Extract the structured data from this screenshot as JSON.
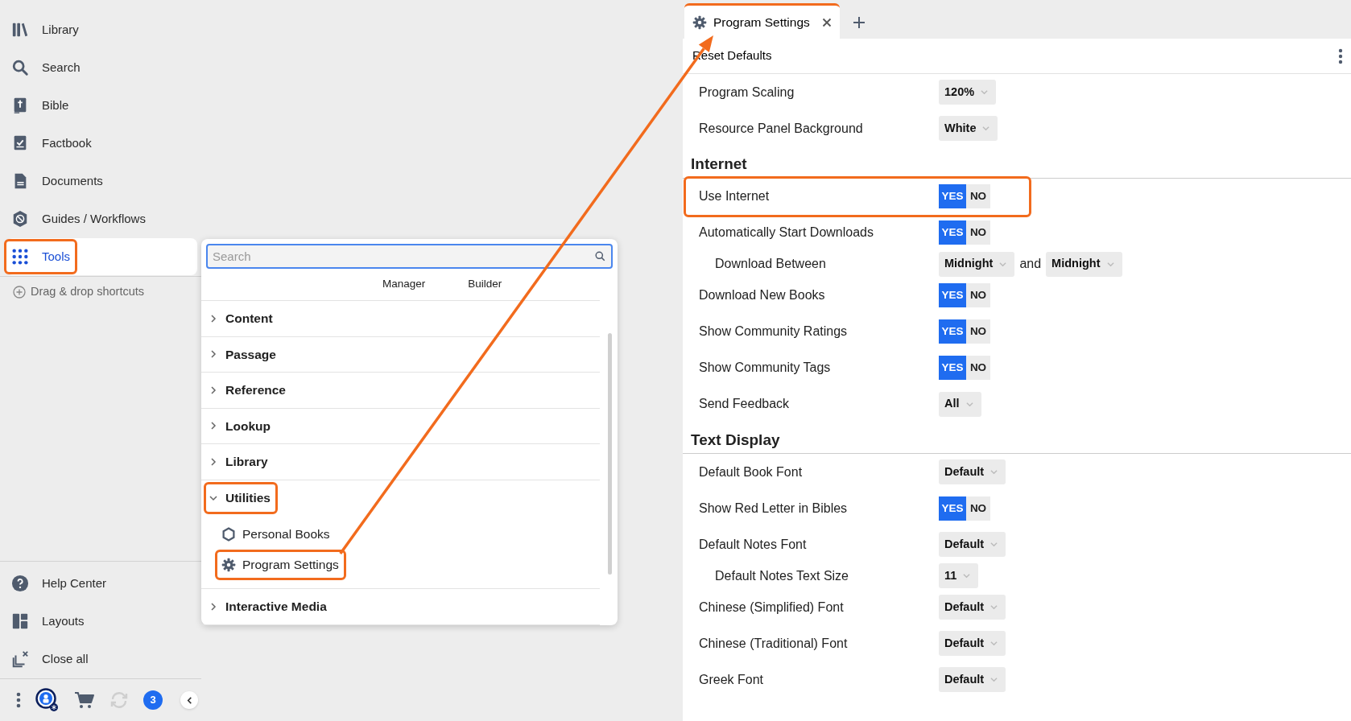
{
  "sidebar": {
    "items": [
      {
        "label": "Library",
        "selected": false,
        "highlighted": false
      },
      {
        "label": "Search",
        "selected": false,
        "highlighted": false
      },
      {
        "label": "Bible",
        "selected": false,
        "highlighted": false
      },
      {
        "label": "Factbook",
        "selected": false,
        "highlighted": false
      },
      {
        "label": "Documents",
        "selected": false,
        "highlighted": false
      },
      {
        "label": "Guides / Workflows",
        "selected": false,
        "highlighted": false
      },
      {
        "label": "Tools",
        "selected": true,
        "highlighted": true
      }
    ],
    "shortcut_hint": "Drag & drop shortcuts",
    "bottom_items": [
      {
        "label": "Help Center"
      },
      {
        "label": "Layouts"
      },
      {
        "label": "Close all"
      }
    ],
    "notification_count": "3"
  },
  "popup": {
    "search": {
      "placeholder": "Search"
    },
    "column_headers": [
      "Manager",
      "Builder"
    ],
    "groups": [
      {
        "label": "Content",
        "expanded": false,
        "highlighted": false
      },
      {
        "label": "Passage",
        "expanded": false,
        "highlighted": false
      },
      {
        "label": "Reference",
        "expanded": false,
        "highlighted": false
      },
      {
        "label": "Lookup",
        "expanded": false,
        "highlighted": false
      },
      {
        "label": "Library",
        "expanded": false,
        "highlighted": false
      },
      {
        "label": "Utilities",
        "expanded": true,
        "highlighted": true,
        "children": [
          {
            "label": "Personal Books",
            "highlighted": false
          },
          {
            "label": "Program Settings",
            "highlighted": true
          }
        ]
      },
      {
        "label": "Interactive Media",
        "expanded": false,
        "highlighted": false
      }
    ]
  },
  "tabs": [
    {
      "label": "Program Settings",
      "selected": true
    }
  ],
  "toolbar": {
    "reset_button": "Reset Defaults"
  },
  "settings": {
    "rows": [
      {
        "kind": "select",
        "label": "Program Scaling",
        "value": "120%",
        "highlighted": false
      },
      {
        "kind": "select",
        "label": "Resource Panel Background",
        "value": "White",
        "highlighted": false
      }
    ],
    "sections": [
      {
        "title": "Internet",
        "rows": [
          {
            "kind": "toggle",
            "label": "Use Internet",
            "on": true,
            "yes": "YES",
            "no": "NO",
            "highlighted": true
          },
          {
            "kind": "toggle",
            "label": "Automatically Start Downloads",
            "on": true,
            "yes": "YES",
            "no": "NO",
            "highlighted": false,
            "children": [
              {
                "kind": "range",
                "label": "Download Between",
                "from": "Midnight",
                "joiner": "and",
                "to": "Midnight",
                "highlighted": false
              }
            ]
          },
          {
            "kind": "toggle",
            "label": "Download New Books",
            "on": true,
            "yes": "YES",
            "no": "NO",
            "highlighted": false
          },
          {
            "kind": "toggle",
            "label": "Show Community Ratings",
            "on": true,
            "yes": "YES",
            "no": "NO",
            "highlighted": false
          },
          {
            "kind": "toggle",
            "label": "Show Community Tags",
            "on": true,
            "yes": "YES",
            "no": "NO",
            "highlighted": false
          },
          {
            "kind": "select",
            "label": "Send Feedback",
            "value": "All",
            "highlighted": false
          }
        ]
      },
      {
        "title": "Text Display",
        "rows": [
          {
            "kind": "select",
            "label": "Default Book Font",
            "value": "Default",
            "highlighted": false
          },
          {
            "kind": "toggle",
            "label": "Show Red Letter in Bibles",
            "on": true,
            "yes": "YES",
            "no": "NO",
            "highlighted": false
          },
          {
            "kind": "select",
            "label": "Default Notes Font",
            "value": "Default",
            "highlighted": false,
            "children": [
              {
                "kind": "select",
                "label": "Default Notes Text Size",
                "value": "11",
                "highlighted": false
              }
            ]
          },
          {
            "kind": "select",
            "label": "Chinese (Simplified) Font",
            "value": "Default",
            "highlighted": false
          },
          {
            "kind": "select",
            "label": "Chinese (Traditional) Font",
            "value": "Default",
            "highlighted": false
          },
          {
            "kind": "select",
            "label": "Greek Font",
            "value": "Default",
            "highlighted": false
          }
        ]
      }
    ]
  }
}
